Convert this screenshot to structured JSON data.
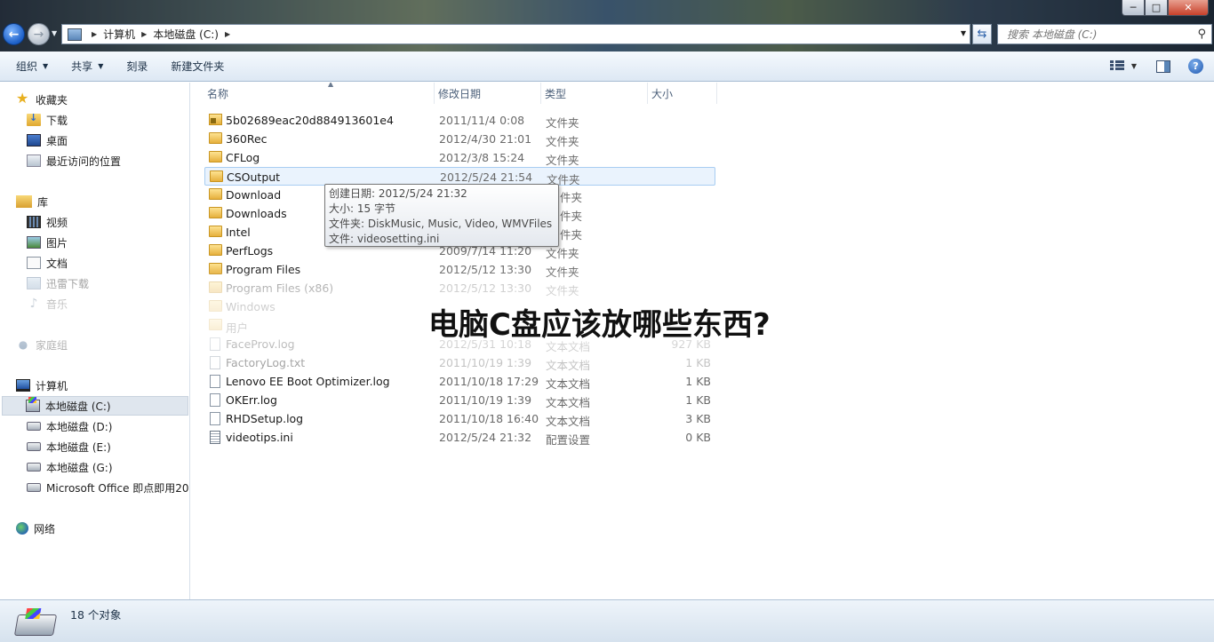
{
  "window": {
    "controls": {
      "minimize": "─",
      "maximize": "□",
      "close": "✕"
    }
  },
  "address": {
    "crumbs": [
      "计算机",
      "本地磁盘 (C:)"
    ]
  },
  "search": {
    "placeholder": "搜索 本地磁盘 (C:)"
  },
  "toolbar": {
    "organize": "组织",
    "share": "共享",
    "burn": "刻录",
    "new_folder": "新建文件夹"
  },
  "sidebar": {
    "favorites": "收藏夹",
    "downloads": "下载",
    "desktop": "桌面",
    "recent": "最近访问的位置",
    "libraries": "库",
    "videos": "视频",
    "pictures": "图片",
    "documents": "文档",
    "xunlei": "迅雷下载",
    "music": "音乐",
    "homegroup": "家庭组",
    "computer": "计算机",
    "drive_c": "本地磁盘 (C:)",
    "drive_d": "本地磁盘 (D:)",
    "drive_e": "本地磁盘 (E:)",
    "drive_g": "本地磁盘 (G:)",
    "office": "Microsoft Office 即点即用20"
  },
  "columns": {
    "name": "名称",
    "date": "修改日期",
    "type": "类型",
    "size": "大小"
  },
  "files": [
    {
      "name": "5b02689eac20d884913601e4",
      "date": "2011/11/4 0:08",
      "type": "文件夹",
      "size": ""
    },
    {
      "name": "360Rec",
      "date": "2012/4/30 21:01",
      "type": "文件夹",
      "size": ""
    },
    {
      "name": "CFLog",
      "date": "2012/3/8 15:24",
      "type": "文件夹",
      "size": ""
    },
    {
      "name": "CSOutput",
      "date": "2012/5/24 21:54",
      "type": "文件夹",
      "size": ""
    },
    {
      "name": "Download",
      "date": "",
      "type": "件夹",
      "size": ""
    },
    {
      "name": "Downloads",
      "date": "",
      "type": "件夹",
      "size": ""
    },
    {
      "name": "Intel",
      "date": "",
      "type": "件夹",
      "size": ""
    },
    {
      "name": "PerfLogs",
      "date": "2009/7/14 11:20",
      "type": "文件夹",
      "size": ""
    },
    {
      "name": "Program Files",
      "date": "2012/5/12 13:30",
      "type": "文件夹",
      "size": ""
    },
    {
      "name": "Program Files (x86)",
      "date": "2012/5/12 13:30",
      "type": "文件夹",
      "size": ""
    },
    {
      "name": "Windows",
      "date": "",
      "type": "",
      "size": ""
    },
    {
      "name": "用户",
      "date": "",
      "type": "",
      "size": ""
    },
    {
      "name": "FaceProv.log",
      "date": "2012/5/31 10:18",
      "type": "文本文档",
      "size": "927 KB"
    },
    {
      "name": "FactoryLog.txt",
      "date": "2011/10/19 1:39",
      "type": "文本文档",
      "size": "1 KB"
    },
    {
      "name": "Lenovo EE Boot Optimizer.log",
      "date": "2011/10/18 17:29",
      "type": "文本文档",
      "size": "1 KB"
    },
    {
      "name": "OKErr.log",
      "date": "2011/10/19 1:39",
      "type": "文本文档",
      "size": "1 KB"
    },
    {
      "name": "RHDSetup.log",
      "date": "2011/10/18 16:40",
      "type": "文本文档",
      "size": "3 KB"
    },
    {
      "name": "videotips.ini",
      "date": "2012/5/24 21:32",
      "type": "配置设置",
      "size": "0 KB"
    }
  ],
  "tooltip": {
    "created": "创建日期: 2012/5/24 21:32",
    "size": "大小: 15 字节",
    "folders": "文件夹: DiskMusic, Music, Video, WMVFiles",
    "file": "文件: videosetting.ini"
  },
  "headline": "电脑C盘应该放哪些东西?",
  "status": {
    "count": "18 个对象"
  }
}
